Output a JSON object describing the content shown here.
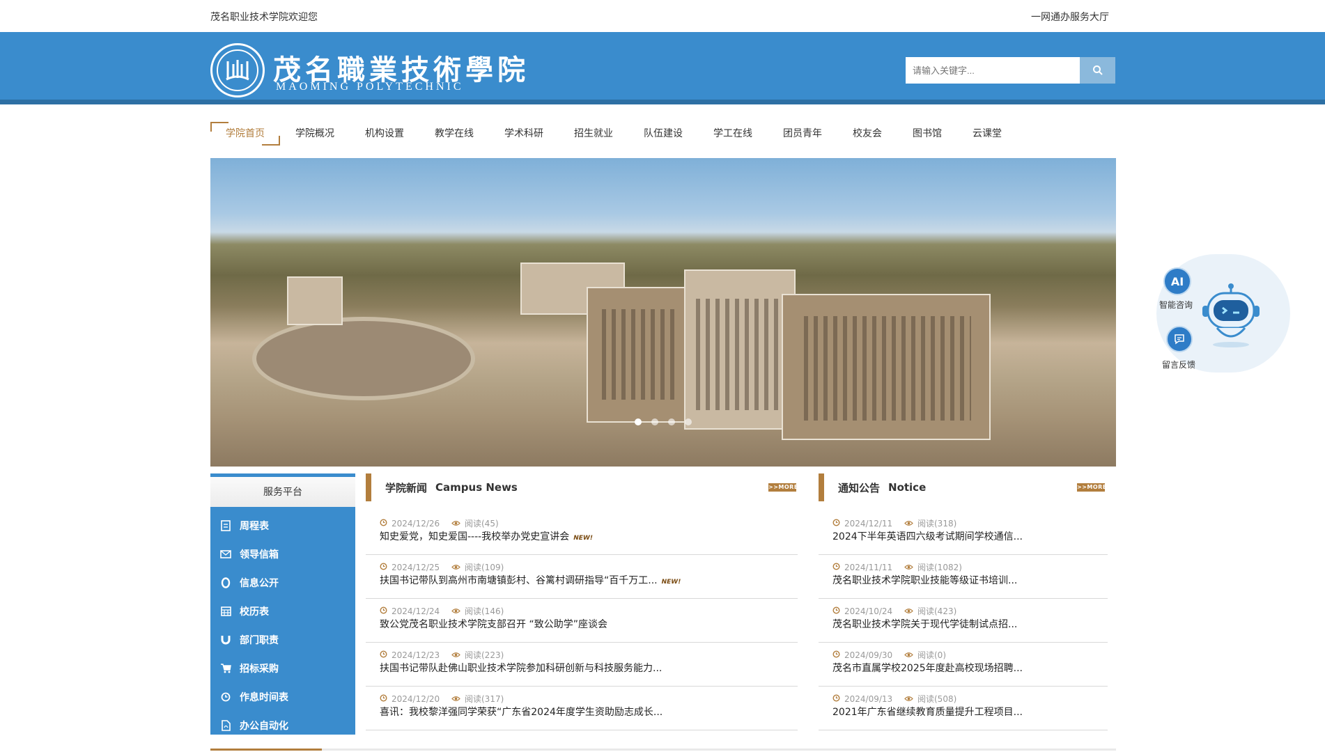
{
  "topbar": {
    "welcome": "茂名职业技术学院欢迎您",
    "service_hall": "一网通办服务大厅"
  },
  "header": {
    "school_name_cn": "茂名職業技術學院",
    "school_name_en": "MAOMING POLYTECHNIC",
    "search_placeholder": "请输入关键字...",
    "logo_icon": "school-seal-logo",
    "colors": {
      "header_bg": "#3a8ccd",
      "accent": "#b27e3d"
    }
  },
  "nav": {
    "items": [
      {
        "label": "学院首页",
        "active": true
      },
      {
        "label": "学院概况"
      },
      {
        "label": "机构设置"
      },
      {
        "label": "教学在线"
      },
      {
        "label": "学术科研"
      },
      {
        "label": "招生就业"
      },
      {
        "label": "队伍建设"
      },
      {
        "label": "学工在线"
      },
      {
        "label": "团员青年"
      },
      {
        "label": "校友会"
      },
      {
        "label": "图书馆"
      },
      {
        "label": "云课堂"
      }
    ]
  },
  "banner": {
    "slide_count": 4,
    "active_slide": 1
  },
  "service_platform": {
    "title": "服务平台",
    "items": [
      {
        "label": "周程表",
        "icon": "calendar-doc-icon"
      },
      {
        "label": "领导信箱",
        "icon": "mail-icon"
      },
      {
        "label": "信息公开",
        "icon": "circle-o-icon"
      },
      {
        "label": "校历表",
        "icon": "calendar-grid-icon"
      },
      {
        "label": "部门职责",
        "icon": "magnet-icon"
      },
      {
        "label": "招标采购",
        "icon": "cart-icon"
      },
      {
        "label": "作息时间表",
        "icon": "clock-icon"
      },
      {
        "label": "办公自动化",
        "icon": "pdf-doc-icon"
      }
    ]
  },
  "campus_news": {
    "title_cn": "学院新闻",
    "title_en": "Campus News",
    "more": ">>MORE",
    "items": [
      {
        "date": "2024/12/26",
        "views": "阅读(45)",
        "title": "知史爱党，知史爱国----我校举办党史宣讲会",
        "new": "NEW!"
      },
      {
        "date": "2024/12/25",
        "views": "阅读(109)",
        "title": "扶国书记带队到高州市南塘镇彭村、谷篱村调研指导“百千万工...",
        "new": "NEW!"
      },
      {
        "date": "2024/12/24",
        "views": "阅读(146)",
        "title": "致公党茂名职业技术学院支部召开 “致公助学”座谈会"
      },
      {
        "date": "2024/12/23",
        "views": "阅读(223)",
        "title": "扶国书记带队赴佛山职业技术学院参加科研创新与科技服务能力..."
      },
      {
        "date": "2024/12/20",
        "views": "阅读(317)",
        "title": "喜讯：我校黎洋强同学荣获“广东省2024年度学生资助励志成长..."
      }
    ]
  },
  "notice": {
    "title_cn": "通知公告",
    "title_en": "Notice",
    "more": ">>MORE",
    "items": [
      {
        "date": "2024/12/11",
        "views": "阅读(318)",
        "title": "2024下半年英语四六级考试期间学校通信..."
      },
      {
        "date": "2024/11/11",
        "views": "阅读(1082)",
        "title": "茂名职业技术学院职业技能等级证书培训..."
      },
      {
        "date": "2024/10/24",
        "views": "阅读(423)",
        "title": "茂名职业技术学院关于现代学徒制试点招..."
      },
      {
        "date": "2024/09/30",
        "views": "阅读(0)",
        "title": "茂名市直属学校2025年度赴高校现场招聘..."
      },
      {
        "date": "2024/09/13",
        "views": "阅读(508)",
        "title": "2021年广东省继续教育质量提升工程项目..."
      }
    ]
  },
  "float_widget": {
    "ai_icon_text": "AI",
    "ai_label": "智能咨询",
    "feedback_label": "留言反馈"
  }
}
